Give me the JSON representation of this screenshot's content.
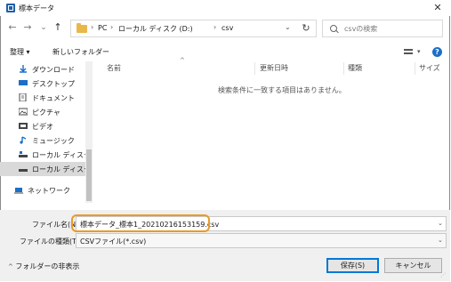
{
  "window": {
    "title": "標本データ",
    "close_glyph": "✕"
  },
  "nav": {
    "back_glyph": "←",
    "forward_glyph": "→",
    "recent_glyph": "⌄",
    "up_glyph": "↑"
  },
  "address": {
    "crumbs": [
      "PC",
      "ローカル ディスク (D:)",
      "csv"
    ],
    "separator": "›",
    "dropdown_glyph": "⌄",
    "refresh_glyph": "↻"
  },
  "search": {
    "placeholder": "csvの検索"
  },
  "toolbar": {
    "organize_label": "整理 ▾",
    "new_folder_label": "新しいフォルダー",
    "view_dd": "▾",
    "help_glyph": "?"
  },
  "sidebar": {
    "items": [
      {
        "label": "ダウンロード",
        "icon": "download-icon",
        "color": "#1b6fc7"
      },
      {
        "label": "デスクトップ",
        "icon": "desktop-icon",
        "color": "#1b6fc7"
      },
      {
        "label": "ドキュメント",
        "icon": "document-icon",
        "color": "#444444"
      },
      {
        "label": "ピクチャ",
        "icon": "picture-icon",
        "color": "#444444"
      },
      {
        "label": "ビデオ",
        "icon": "video-icon",
        "color": "#444444"
      },
      {
        "label": "ミュージック",
        "icon": "music-icon",
        "color": "#1b6fc7"
      },
      {
        "label": "ローカル ディスク (C",
        "icon": "drive-icon",
        "color": "#444444"
      },
      {
        "label": "ローカル ディスク (D",
        "icon": "drive-icon",
        "color": "#444444"
      },
      {
        "label": "ネットワーク",
        "icon": "network-icon",
        "color": "#1b6fc7"
      }
    ],
    "selected_index": 7
  },
  "file_list": {
    "columns": [
      "名前",
      "更新日時",
      "種類",
      "サイズ"
    ],
    "sort_glyph": "^",
    "empty_message": "検索条件に一致する項目はありません。"
  },
  "form": {
    "filename_label": "ファイル名(N):",
    "filename_value": "標本データ_標本1_20210216153159.csv",
    "filetype_label": "ファイルの種類(T):",
    "filetype_value": "CSVファイル(*.csv)",
    "dd_glyph": "⌄"
  },
  "buttons": {
    "save_label": "保存(S)",
    "cancel_label": "キャンセル"
  },
  "footer": {
    "hide_folders_label": "フォルダーの非表示",
    "chevron_glyph": "^"
  },
  "colors": {
    "accent": "#0078d7",
    "highlight": "#e89b2a",
    "folder": "#e8b84a"
  }
}
